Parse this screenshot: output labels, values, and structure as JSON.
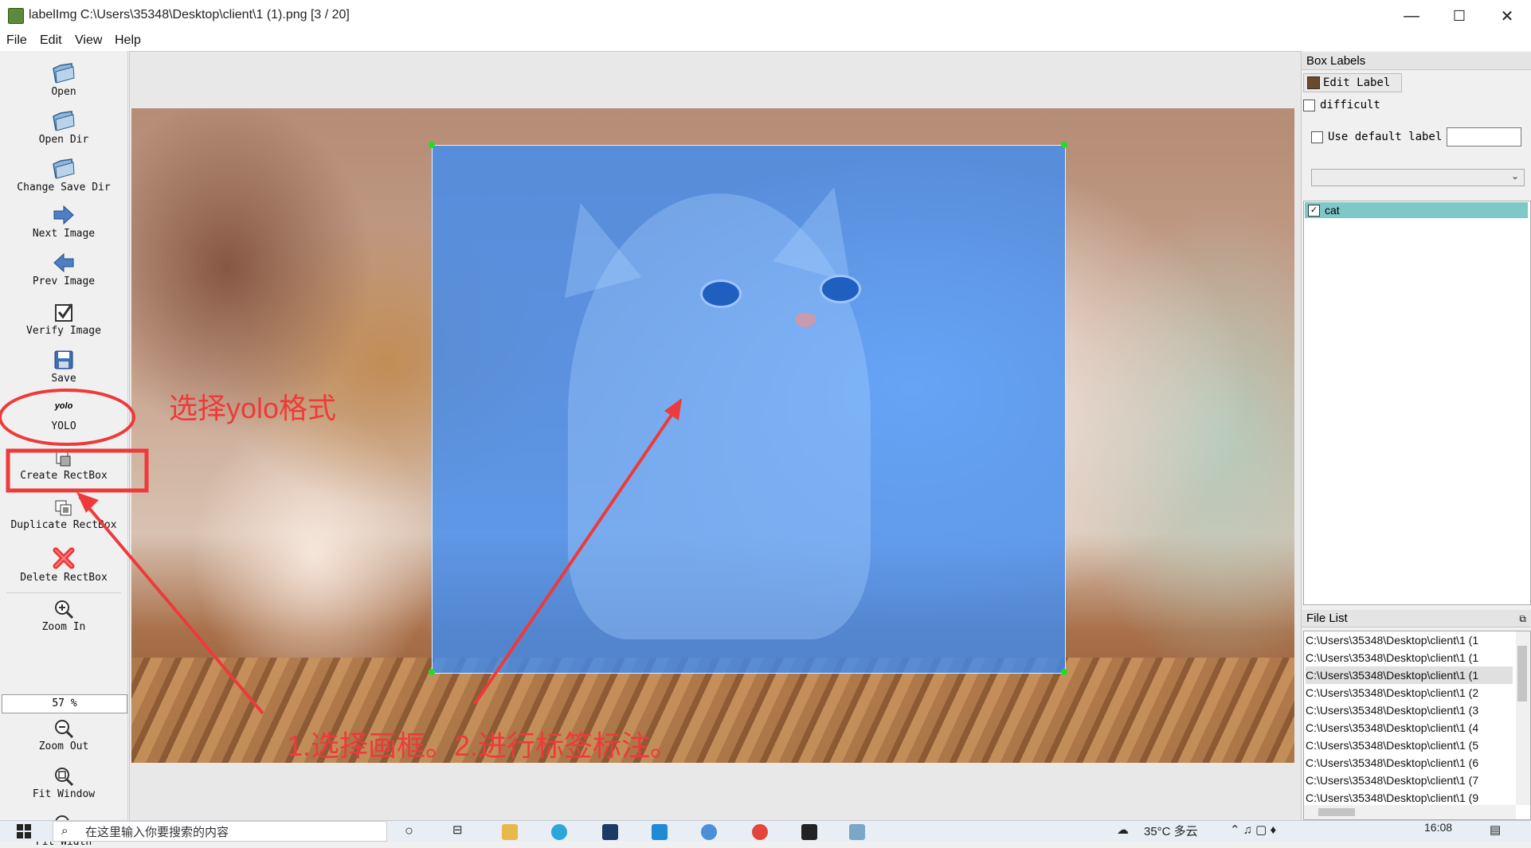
{
  "window": {
    "title": "labelImg C:\\Users\\35348\\Desktop\\client\\1 (1).png [3 / 20]",
    "minimize": "—",
    "maximize": "☐",
    "close": "✕"
  },
  "menu": {
    "file": "File",
    "edit": "Edit",
    "view": "View",
    "help": "Help"
  },
  "toolbar": {
    "open": "Open",
    "open_dir": "Open Dir",
    "change_save_dir": "Change Save Dir",
    "next_image": "Next Image",
    "prev_image": "Prev Image",
    "verify_image": "Verify Image",
    "save": "Save",
    "format_icon_text": "yolo",
    "format": "YOLO",
    "create_rectbox": "Create RectBox",
    "duplicate_rectbox": "Duplicate RectBox",
    "delete_rectbox": "Delete RectBox",
    "zoom_in": "Zoom In",
    "zoom_value": "57 %",
    "zoom_out": "Zoom Out",
    "fit_window": "Fit Window",
    "fit_width": "Fit Width"
  },
  "annotations": {
    "format_note": "选择yolo格式",
    "steps_note": "1.选择画框。2.进行标签标注。"
  },
  "box_labels": {
    "title": "Box Labels",
    "edit_label": "Edit Label",
    "difficult": "difficult",
    "use_default_label": "Use default label",
    "default_label_value": "",
    "labels": [
      "cat"
    ]
  },
  "file_list": {
    "title": "File List",
    "items": [
      "C:\\Users\\35348\\Desktop\\client\\1 (1",
      "C:\\Users\\35348\\Desktop\\client\\1 (1",
      "C:\\Users\\35348\\Desktop\\client\\1 (1",
      "C:\\Users\\35348\\Desktop\\client\\1 (2",
      "C:\\Users\\35348\\Desktop\\client\\1 (3",
      "C:\\Users\\35348\\Desktop\\client\\1 (4",
      "C:\\Users\\35348\\Desktop\\client\\1 (5",
      "C:\\Users\\35348\\Desktop\\client\\1 (6",
      "C:\\Users\\35348\\Desktop\\client\\1 (7",
      "C:\\Users\\35348\\Desktop\\client\\1 (9"
    ],
    "selected_index": 2
  },
  "taskbar": {
    "search_placeholder": "在这里输入你要搜索的内容",
    "weather": "35°C 多云",
    "time": "16:08"
  },
  "colors": {
    "box_fill": "#3c8cf5",
    "annotation_red": "#ee3a3a",
    "selected_label_bg": "#7ec8c8"
  }
}
